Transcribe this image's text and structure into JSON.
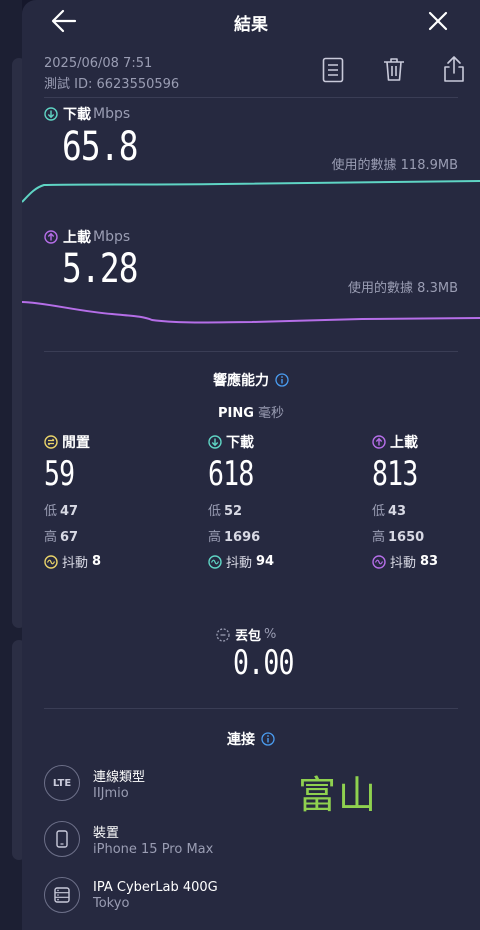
{
  "header": {
    "title": "結果",
    "back_icon": "arrow-left-icon",
    "close_icon": "close-icon"
  },
  "meta": {
    "date": "2025/06/08 7:51",
    "test_id": "測試 ID: 6623550596"
  },
  "actions": [
    {
      "name": "notes-icon"
    },
    {
      "name": "trash-icon"
    },
    {
      "name": "share-icon"
    }
  ],
  "download": {
    "label": "下載",
    "unit": "Mbps",
    "value": "65.8",
    "data_used": "使用的數據 118.9MB",
    "color": "#5fd4c4"
  },
  "upload": {
    "label": "上載",
    "unit": "Mbps",
    "value": "5.28",
    "data_used": "使用的數據 8.3MB",
    "color": "#b56ee8"
  },
  "responsiveness": {
    "title": "響應能力",
    "ping_label": "PING",
    "ping_unit": "毫秒",
    "idle": {
      "label": "閒置",
      "value": "59",
      "low_label": "低",
      "low": "47",
      "high_label": "高",
      "high": "67",
      "jitter_label": "抖動",
      "jitter": "8",
      "color": "#e9d36a"
    },
    "down": {
      "label": "下載",
      "value": "618",
      "low_label": "低",
      "low": "52",
      "high_label": "高",
      "high": "1696",
      "jitter_label": "抖動",
      "jitter": "94",
      "color": "#5fd4c4"
    },
    "up": {
      "label": "上載",
      "value": "813",
      "low_label": "低",
      "low": "43",
      "high_label": "高",
      "high": "1650",
      "jitter_label": "抖動",
      "jitter": "83",
      "color": "#b56ee8"
    }
  },
  "packet_loss": {
    "label": "丟包",
    "unit": "%",
    "value": "0.00"
  },
  "connection": {
    "title": "連接",
    "items": [
      {
        "icon": "LTE",
        "title": "連線類型",
        "subtitle": "IIJmio"
      },
      {
        "icon": "phone-icon",
        "title": "裝置",
        "subtitle": "iPhone 15 Pro Max"
      },
      {
        "icon": "server-icon",
        "title": "IPA CyberLab 400G",
        "subtitle": "Tokyo"
      }
    ]
  },
  "overlay_text": "富山"
}
